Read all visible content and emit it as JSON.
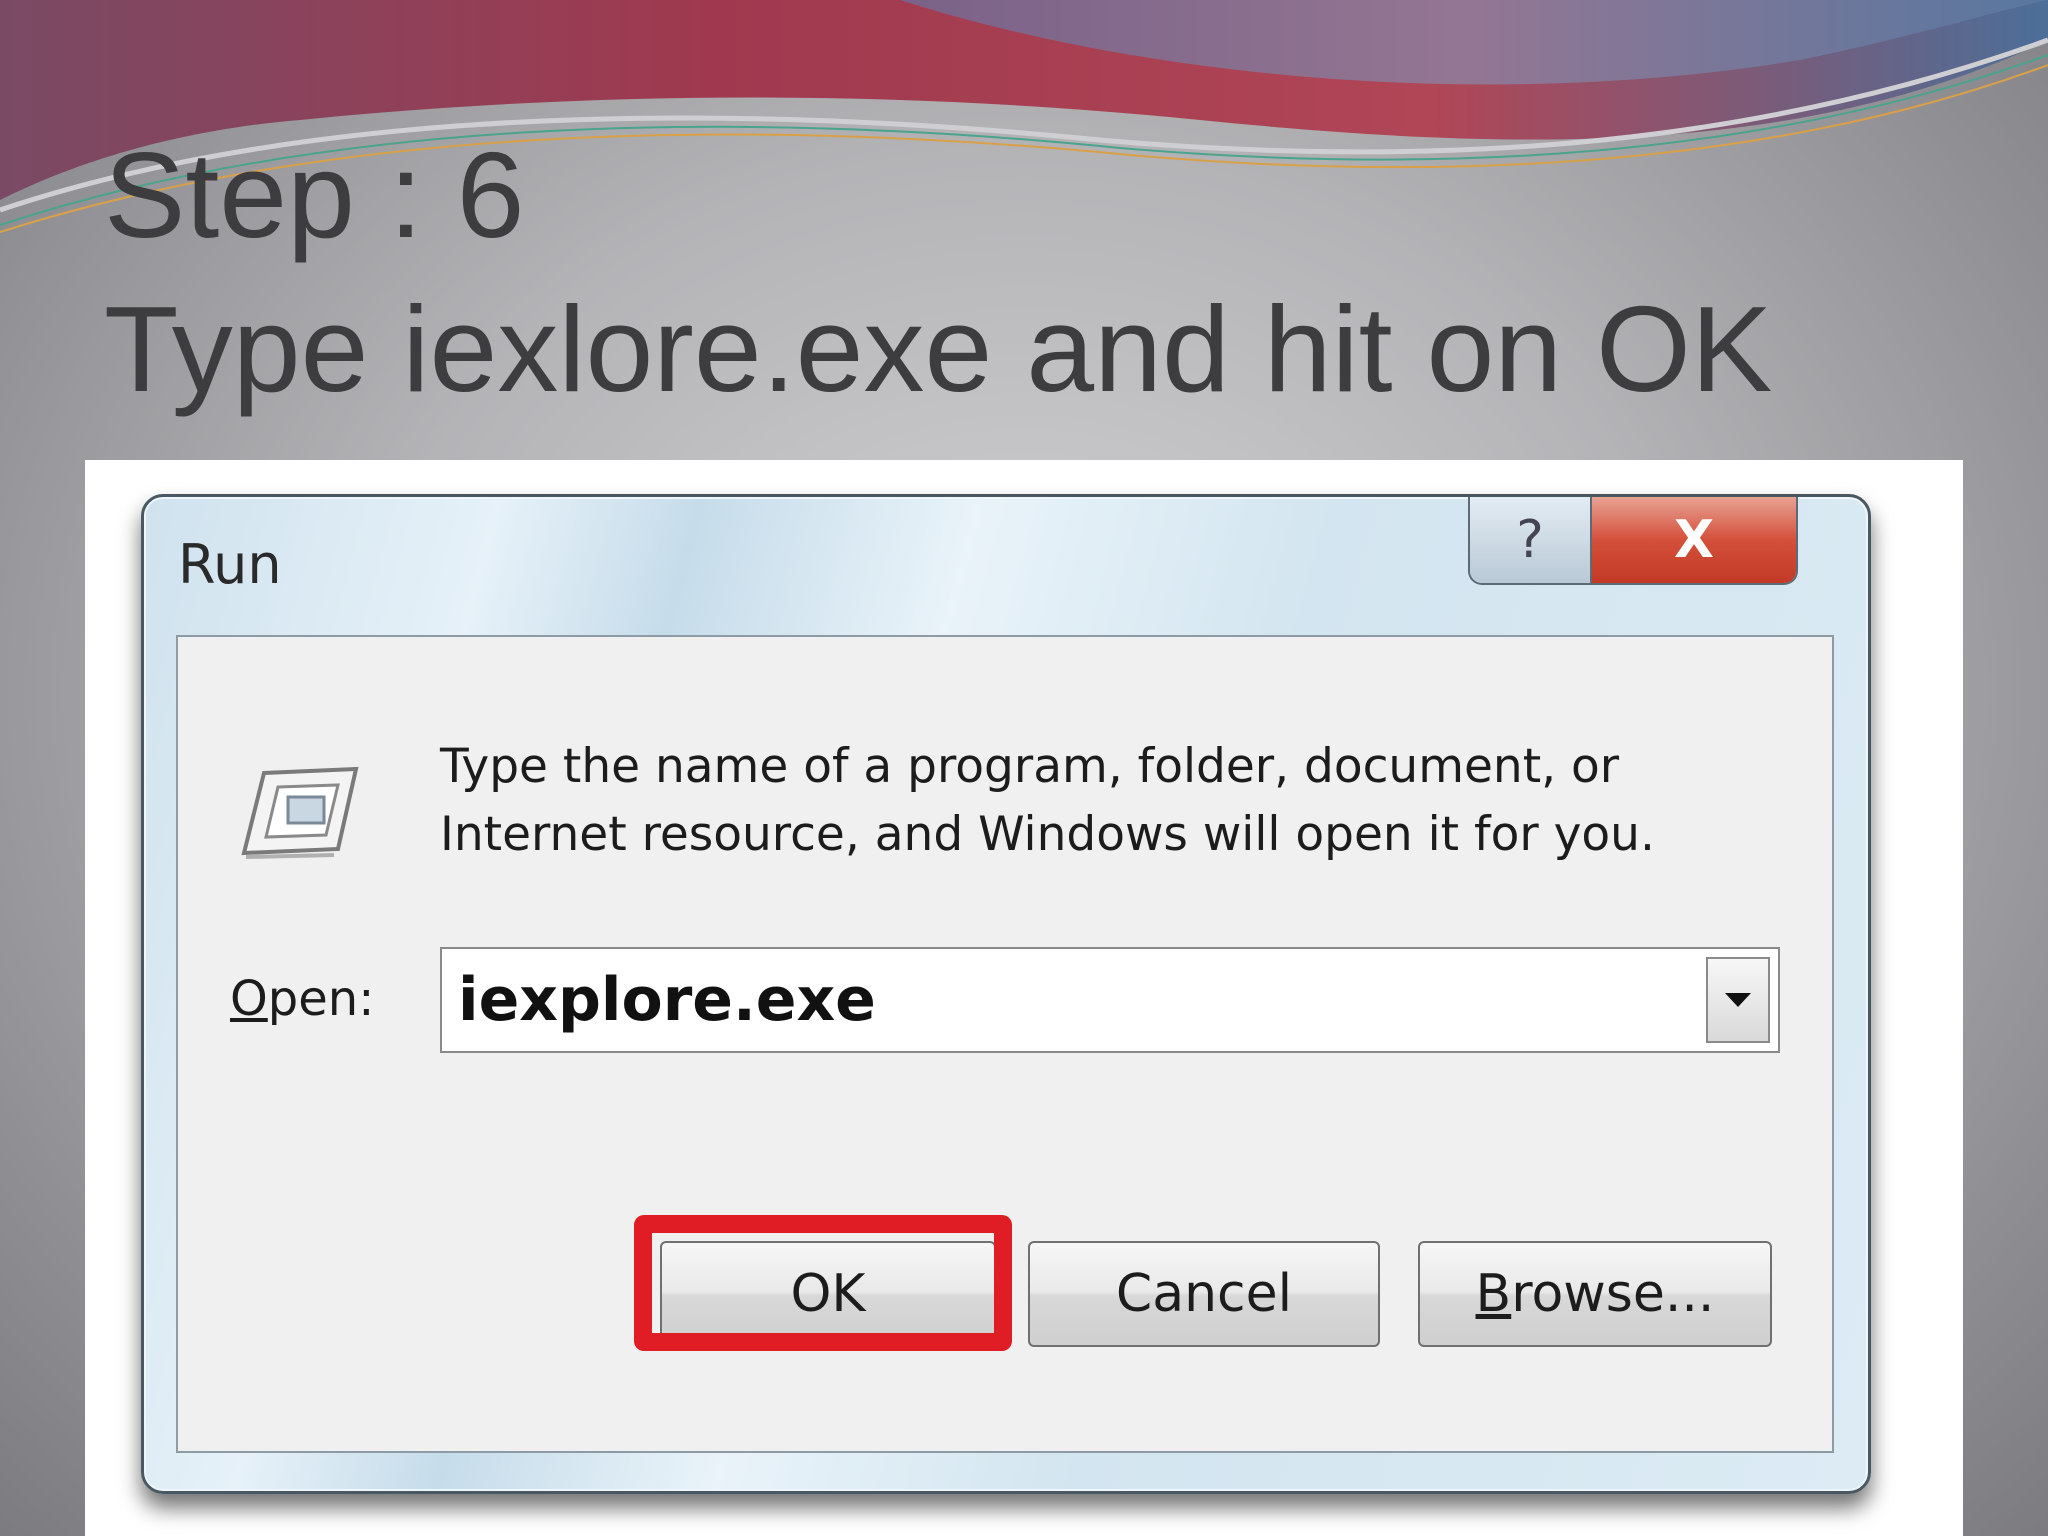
{
  "slide": {
    "title_line1": "Step : 6",
    "title_line2": "Type iexlore.exe and hit on OK",
    "accent_colors": {
      "wave_red": "#a0394f",
      "wave_blue": "#4c6e98",
      "highlight": "#e01c24"
    }
  },
  "dialog": {
    "title": "Run",
    "help_label": "?",
    "close_label": "X",
    "icon": "run-program-icon",
    "instructions_line1": "Type the name of a program, folder, document, or",
    "instructions_line2": "Internet resource, and Windows will open it for you.",
    "open_label_mnemonic": "O",
    "open_label_rest": "pen:",
    "open_value": "iexplore.exe",
    "dropdown_icon": "chevron-down-icon",
    "ok_label": "OK",
    "cancel_label": "Cancel",
    "browse_label_mnemonic": "B",
    "browse_label_rest": "rowse..."
  }
}
